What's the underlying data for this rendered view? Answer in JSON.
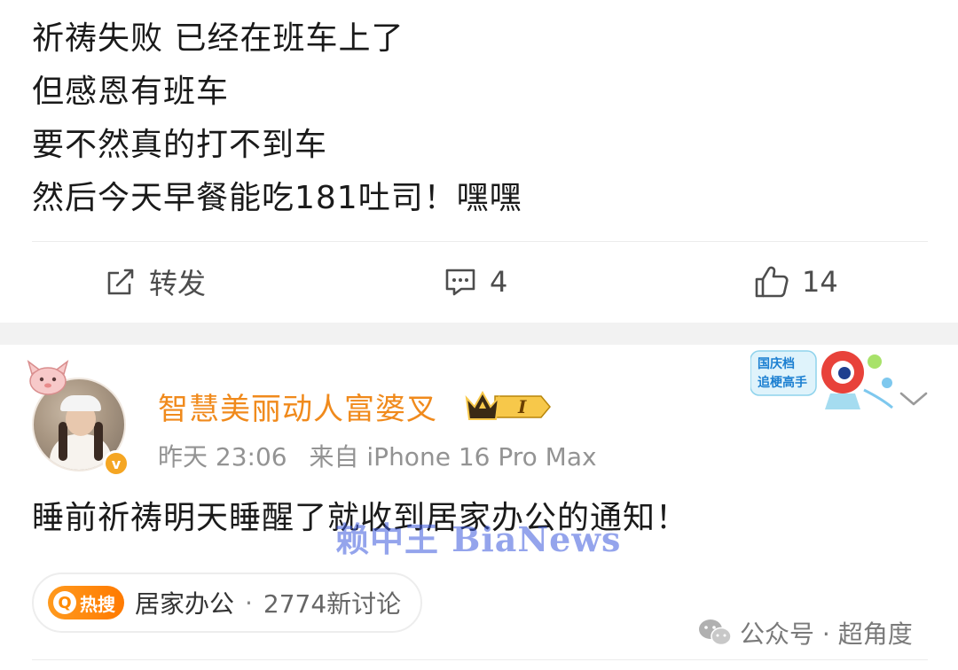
{
  "post1": {
    "lines": [
      "祈祷失败 已经在班车上了",
      "但感恩有班车",
      "要不然真的打不到车",
      "然后今天早餐能吃181吐司！嘿嘿"
    ],
    "actions": {
      "repost_label": "转发",
      "comment_count": "4",
      "like_count": "14"
    }
  },
  "post2": {
    "username": "智慧美丽动人富婆叉",
    "vip_level": "I",
    "time": "昨天 23:06",
    "source": "来自 iPhone 16 Pro Max",
    "text": "睡前祈祷明天睡醒了就收到居家办公的通知！",
    "decor_badge_line1": "国庆档",
    "decor_badge_line2": "追梗高手",
    "topic": {
      "hot_label": "热搜",
      "name": "居家办公",
      "separator": "·",
      "count": "2774新讨论"
    }
  },
  "watermark": "赖中王 BiaNews",
  "source_credit": "公众号 · 超角度",
  "colors": {
    "username": "#f08a1c",
    "meta": "#939393",
    "hot_tag": "#ff8a00",
    "watermark": "#3c5adc"
  }
}
